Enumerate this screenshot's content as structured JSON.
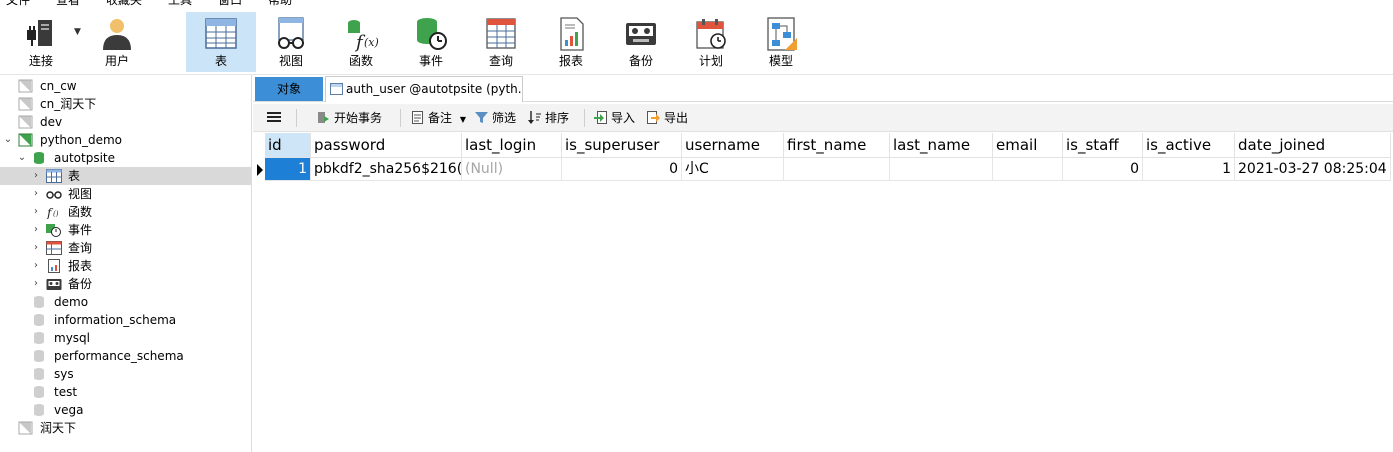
{
  "menu": [
    "文件",
    "查看",
    "收藏夹",
    "工具",
    "窗口",
    "帮助"
  ],
  "toolbar": {
    "items": [
      {
        "label": "连接",
        "icon": "connection-icon"
      },
      {
        "label": "用户",
        "icon": "user-icon"
      },
      {
        "label": "表",
        "icon": "table-icon",
        "active": true
      },
      {
        "label": "视图",
        "icon": "view-icon"
      },
      {
        "label": "函数",
        "icon": "function-icon"
      },
      {
        "label": "事件",
        "icon": "event-icon"
      },
      {
        "label": "查询",
        "icon": "query-icon"
      },
      {
        "label": "报表",
        "icon": "report-icon"
      },
      {
        "label": "备份",
        "icon": "backup-icon"
      },
      {
        "label": "计划",
        "icon": "schedule-icon"
      },
      {
        "label": "模型",
        "icon": "model-icon"
      }
    ]
  },
  "sidebar": {
    "items": [
      {
        "label": "cn_cw"
      },
      {
        "label": "cn_润天下"
      },
      {
        "label": "dev"
      },
      {
        "label": "python_demo"
      },
      {
        "label": "autotpsite"
      },
      {
        "label": "表"
      },
      {
        "label": "视图"
      },
      {
        "label": "函数"
      },
      {
        "label": "事件"
      },
      {
        "label": "查询"
      },
      {
        "label": "报表"
      },
      {
        "label": "备份"
      },
      {
        "label": "demo"
      },
      {
        "label": "information_schema"
      },
      {
        "label": "mysql"
      },
      {
        "label": "performance_schema"
      },
      {
        "label": "sys"
      },
      {
        "label": "test"
      },
      {
        "label": "vega"
      },
      {
        "label": "润天下"
      }
    ]
  },
  "tabs": {
    "objects": "对象",
    "active_table": "auth_user @autotpsite (pyth..."
  },
  "subtoolbar": {
    "begin_transaction": "开始事务",
    "note": "备注",
    "filter": "筛选",
    "sort": "排序",
    "import": "导入",
    "export": "导出"
  },
  "grid": {
    "columns": [
      "id",
      "password",
      "last_login",
      "is_superuser",
      "username",
      "first_name",
      "last_name",
      "email",
      "is_staff",
      "is_active",
      "date_joined"
    ],
    "rows": [
      [
        "1",
        "pbkdf2_sha256$216(",
        "(Null)",
        "0",
        "小C",
        "",
        "",
        "",
        "0",
        "1",
        "2021-03-27 08:25:04"
      ]
    ]
  },
  "colors": {
    "active_tool_bg": "#cce4f7",
    "objects_tab_bg": "#3c8fd6",
    "selected_cell_bg": "#1e7fd7",
    "null_text": "#a6a6a6"
  }
}
